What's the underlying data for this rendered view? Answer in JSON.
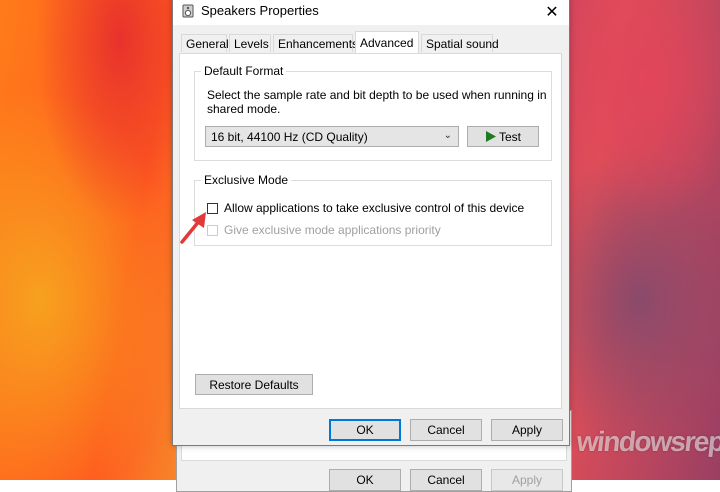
{
  "window": {
    "title": "Speakers Properties",
    "close_glyph": "✕"
  },
  "tabs": [
    {
      "label": "General"
    },
    {
      "label": "Levels"
    },
    {
      "label": "Enhancements"
    },
    {
      "label": "Advanced",
      "active": true
    },
    {
      "label": "Spatial sound"
    }
  ],
  "default_format": {
    "group_label": "Default Format",
    "description": "Select the sample rate and bit depth to be used when running in shared mode.",
    "selected_format": "16 bit, 44100 Hz (CD Quality)",
    "test_label": "Test"
  },
  "exclusive_mode": {
    "group_label": "Exclusive Mode",
    "allow_exclusive_label": "Allow applications to take exclusive control of this device",
    "allow_exclusive_checked": false,
    "priority_label": "Give exclusive mode applications priority",
    "priority_checked": false,
    "priority_enabled": false
  },
  "restore_defaults_label": "Restore Defaults",
  "footer": {
    "ok_label": "OK",
    "cancel_label": "Cancel",
    "apply_label": "Apply"
  },
  "background_dialog": {
    "ok_label": "OK",
    "cancel_label": "Cancel",
    "apply_label": "Apply"
  },
  "watermark": "windowsreport",
  "colors": {
    "accent": "#0078d7",
    "play_icon": "#1e7b1e",
    "annotation_arrow": "#e23a3a"
  }
}
